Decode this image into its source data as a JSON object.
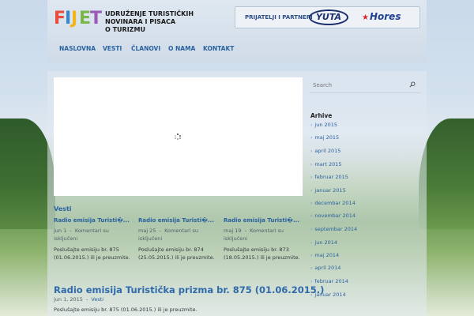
{
  "header": {
    "logo_text": "FIJET",
    "org_name_lines": [
      "UDRUŽENJE TURISTIČKIH",
      "NOVINARA I PISACA",
      "O TURIZMU"
    ],
    "partners_label": "PRIJATELJI I PARTNERI",
    "partner_logos": [
      "YUTA",
      "Hores"
    ]
  },
  "nav": {
    "items": [
      "NASLOVNA",
      "VESTI",
      "ČLANOVI",
      "O NAMA",
      "KONTAKT"
    ]
  },
  "search": {
    "placeholder": "Search"
  },
  "section": {
    "title": "Vesti"
  },
  "posts": [
    {
      "title": "Radio emisija Turisti�...",
      "date": "jun 1",
      "comments": "Komentari su isključeni",
      "excerpt": "Poslušajte emisiju br. 875 (01.06.2015.) ili je preuzmite."
    },
    {
      "title": "Radio emisija Turisti�...",
      "date": "maj 25",
      "comments": "Komentari su isključeni",
      "excerpt": "Poslušajte emisiju br. 874 (25.05.2015.) ili je preuzmite."
    },
    {
      "title": "Radio emisija Turisti�...",
      "date": "maj 19",
      "comments": "Komentari su isključeni",
      "excerpt": "Poslušajte emisiju br. 873 (18.05.2015.) ili je preuzmite."
    }
  ],
  "featured": {
    "title": "Radio emisija Turistička prizma br. 875 (01.06.2015.)",
    "date": "jun 1, 2015",
    "category": "Vesti",
    "excerpt": "Poslušajte emisiju br. 875 (01.06.2015.) ili je preuzmite."
  },
  "archive": {
    "title": "Arhive",
    "items": [
      "jun 2015",
      "maj 2015",
      "april 2015",
      "mart 2015",
      "februar 2015",
      "januar 2015",
      "decembar 2014",
      "novembar 2014",
      "septembar 2014",
      "jun 2014",
      "maj 2014",
      "april 2014",
      "februar 2014",
      "januar 2014"
    ]
  },
  "colors": {
    "link": "#2a62a0",
    "logo": [
      "#e94b3c",
      "#3a86c8",
      "#f2b51c",
      "#7ab648",
      "#9b59b6"
    ]
  }
}
